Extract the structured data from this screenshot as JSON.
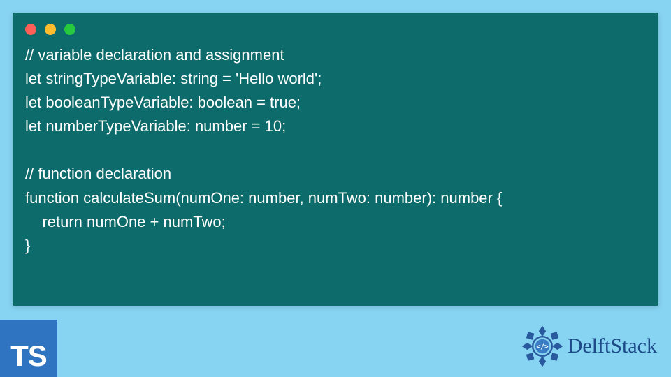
{
  "code": {
    "line1": "// variable declaration and assignment",
    "line2": "let stringTypeVariable: string = 'Hello world';",
    "line3": "let booleanTypeVariable: boolean = true;",
    "line4": "let numberTypeVariable: number = 10;",
    "line5": "",
    "line6": "// function declaration",
    "line7": "function calculateSum(numOne: number, numTwo: number): number {",
    "line8": "    return numOne + numTwo;",
    "line9": "}"
  },
  "badges": {
    "ts_label": "TS",
    "delft_label": "DelftStack"
  },
  "colors": {
    "background": "#87d4f2",
    "code_bg": "#0e6b6b",
    "ts_badge": "#2f74c0",
    "delft_text": "#1e4a8a"
  }
}
